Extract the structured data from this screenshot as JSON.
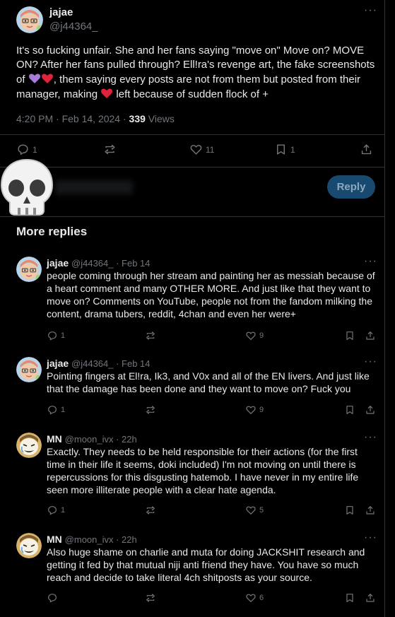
{
  "main_tweet": {
    "name": "jajae",
    "handle": "@j44364_",
    "text_parts": [
      "It's so fucking unfair. She and her fans saying  \"move on\" Move on? MOVE ON? After her fans pulled through? Ell!ra's revenge art, the fake screenshots of ",
      ", them saying every posts are not from them but posted from their manager, making ",
      " left because of sudden flock of +"
    ],
    "time": "4:20 PM · Feb 14, 2024 · ",
    "views_count": "339",
    "views_label": " Views",
    "stats": {
      "replies": "1",
      "reposts": "",
      "likes": "11",
      "bookmarks": "1"
    }
  },
  "compose": {
    "reply_button": "Reply"
  },
  "section_title": "More replies",
  "replies": [
    {
      "name": "jajae",
      "handle": "@j44364_ · Feb 14",
      "text": "people coming through her stream and painting her as messiah because of a heart comment and many OTHER MORE. And just like that they want to move on? Comments on YouTube, people not from the fandom milking the content, drama tubers, reddit, 4chan and even her were+",
      "replies": "1",
      "likes": "9"
    },
    {
      "name": "jajae",
      "handle": "@j44364_ · Feb 14",
      "text": "Pointing fingers at El!ra, Ik3, and V0x and all of the EN livers. And just like that the damage has been done and they want to move on? Fuck you",
      "replies": "1",
      "likes": "9"
    },
    {
      "name": "MN",
      "handle": "@moon_ivx · 22h",
      "text": "Exactly. They needs to be held responsible for their actions (for the first time in their life it seems, doki included) I'm not moving on until there is repercussions for this disgusting hatemob. I have never in my entire life seen more illiterate people with a clear hate agenda.",
      "replies": "1",
      "likes": "5"
    },
    {
      "name": "MN",
      "handle": "@moon_ivx · 22h",
      "text": "Also huge shame on charlie and muta for doing JACKSHIT research and getting it fed by that mutual niji anti friend they have. You have so much reach and decide to take literal 4ch shitposts as your source.",
      "replies": "",
      "likes": "6"
    }
  ],
  "icons": {
    "reply": "reply-icon",
    "repost": "repost-icon",
    "like": "heart-icon",
    "bookmark": "bookmark-icon",
    "share": "share-icon",
    "more": "more-icon"
  },
  "colors": {
    "background": "#000000",
    "text": "#e7e9ea",
    "secondary": "#71767b",
    "divider": "#2f3336",
    "reply_button": "#174a6e",
    "purple_heart": "#a77bd9",
    "red_heart": "#e0223a"
  }
}
